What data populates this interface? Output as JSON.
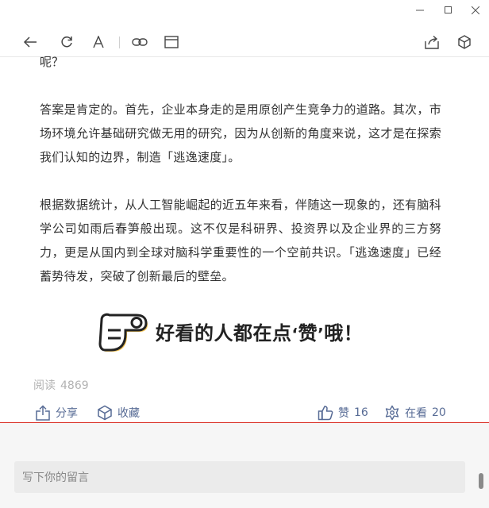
{
  "article": {
    "first_line": "呢？",
    "paragraphs": [
      "答案是肯定的。首先，企业本身走的是用原创产生竞争力的道路。其次，市场环境允许基础研究做无用的研究，因为从创新的角度来说，这才是在探索我们认知的边界，制造「逃逸速度」。",
      "根据数据统计，从人工智能崛起的近五年来看，伴随这一现象的，还有脑科学公司如雨后春笋般出现。这不仅是科研界、投资界以及企业界的三方努力，更是从国内到全球对脑科学重要性的一个空前共识。「逃逸速度」已经蓄势待发，突破了创新最后的壁垒。"
    ]
  },
  "banner": {
    "text_before": "好看的人都在点",
    "quote_open": "‘",
    "highlight": "赞",
    "quote_close": "’",
    "text_after": "哦！"
  },
  "stats": {
    "read_label": "阅读",
    "read_count": "4869"
  },
  "actions": {
    "share": "分享",
    "favorite": "收藏",
    "like_label": "赞",
    "like_count": "16",
    "watching_label": "在看",
    "watching_count": "20"
  },
  "comment": {
    "placeholder": "写下你的留言"
  },
  "colors": {
    "link_blue": "#576b95",
    "divider_red": "#d9281e",
    "muted_gray": "#b2b2b2"
  }
}
